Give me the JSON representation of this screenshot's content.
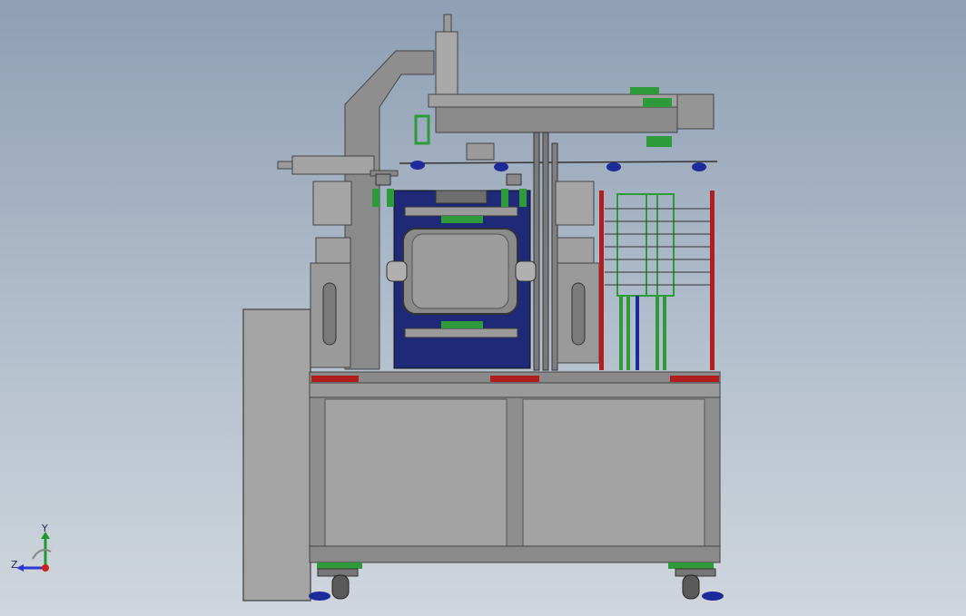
{
  "viewport": {
    "background_top": "#8f9fb4",
    "background_bottom": "#d0d6dd"
  },
  "model": {
    "frame_color": "#8c8c8c",
    "panel_color": "#a0a0a0",
    "dark_steel": "#6e6e6e",
    "accent_red": "#b01e1e",
    "accent_green": "#2f9a3a",
    "accent_blue": "#1e2a78"
  },
  "triad": {
    "x_label": "",
    "y_label": "Y",
    "z_label": "Z",
    "y_color": "#1f9a2f",
    "z_color": "#2a3ad0",
    "x_color": "#d02020"
  }
}
